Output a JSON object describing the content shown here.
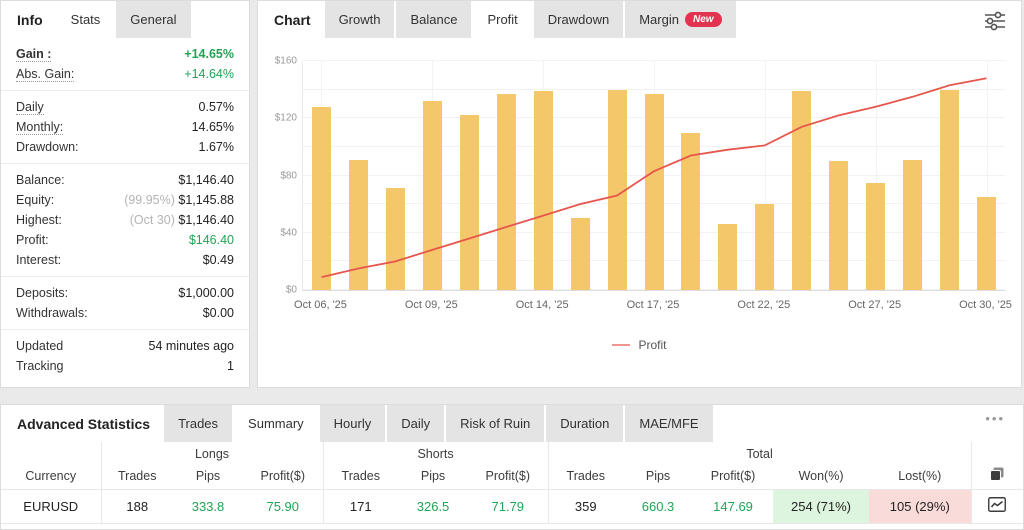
{
  "colors": {
    "green": "#22a455",
    "badge_red": "#e23350",
    "muted_prefix": "#b4b4b4"
  },
  "left_panel": {
    "title": "Info",
    "tabs": [
      {
        "label": "Stats",
        "active": true
      },
      {
        "label": "General",
        "active": false
      }
    ],
    "groups": [
      {
        "rows": [
          {
            "label": "Gain :",
            "value": "+14.65%",
            "label_class": "bold dotted",
            "value_class": "green bold"
          },
          {
            "label": "Abs. Gain:",
            "value": "+14.64%",
            "label_class": "dotted",
            "value_class": "green"
          }
        ]
      },
      {
        "rows": [
          {
            "label": "Daily",
            "value": "0.57%",
            "label_class": "dotted"
          },
          {
            "label": "Monthly:",
            "value": "14.65%",
            "label_class": "dotted"
          },
          {
            "label": "Drawdown:",
            "value": "1.67%"
          }
        ]
      },
      {
        "rows": [
          {
            "label": "Balance:",
            "value": "$1,146.40"
          },
          {
            "label": "Equity:",
            "prefix": "(99.95%) ",
            "value": "$1,145.88"
          },
          {
            "label": "Highest:",
            "prefix": "(Oct 30) ",
            "value": "$1,146.40"
          },
          {
            "label": "Profit:",
            "value": "$146.40",
            "value_class": "green"
          },
          {
            "label": "Interest:",
            "value": "$0.49"
          }
        ]
      },
      {
        "rows": [
          {
            "label": "Deposits:",
            "value": "$1,000.00"
          },
          {
            "label": "Withdrawals:",
            "value": "$0.00"
          }
        ]
      },
      {
        "rows": [
          {
            "label": "Updated",
            "value": "54 minutes ago"
          },
          {
            "label": "Tracking",
            "value": "1"
          }
        ]
      }
    ]
  },
  "chart_panel": {
    "title": "Chart",
    "tabs": [
      {
        "label": "Growth"
      },
      {
        "label": "Balance"
      },
      {
        "label": "Profit",
        "active": true
      },
      {
        "label": "Drawdown"
      },
      {
        "label": "Margin",
        "badge": "New"
      }
    ]
  },
  "chart_data": {
    "type": "bar",
    "title": "",
    "xlabel": "",
    "ylabel": "",
    "ylim": [
      0,
      160
    ],
    "ytick_major": 40,
    "ytick_minor": 20,
    "ytick_prefix": "$",
    "grid": true,
    "bar_color": "#f4c86a",
    "line_color": "#e6564d",
    "bars": [
      128,
      91,
      71,
      132,
      122,
      137,
      139,
      50,
      140,
      137,
      110,
      46,
      60,
      139,
      90,
      75,
      91,
      140,
      65
    ],
    "series": [
      {
        "name": "Profit",
        "type": "line",
        "values": [
          9,
          15,
          20,
          28,
          36,
          44,
          52,
          60,
          66,
          83,
          94,
          98,
          101,
          114,
          122,
          128,
          135,
          143,
          148
        ]
      }
    ],
    "xticks": [
      {
        "index": 0,
        "label": "Oct 06, '25"
      },
      {
        "index": 3,
        "label": "Oct 09, '25"
      },
      {
        "index": 6,
        "label": "Oct 14, '25"
      },
      {
        "index": 9,
        "label": "Oct 17, '25"
      },
      {
        "index": 12,
        "label": "Oct 22, '25"
      },
      {
        "index": 15,
        "label": "Oct 27, '25"
      },
      {
        "index": 18,
        "label": "Oct 30, '25"
      }
    ],
    "legend": [
      {
        "label": "Profit",
        "color": "#f0968e"
      }
    ],
    "legend_position": "bottom-center"
  },
  "bottom_panel": {
    "title": "Advanced Statistics",
    "tabs": [
      {
        "label": "Trades"
      },
      {
        "label": "Summary",
        "active": true
      },
      {
        "label": "Hourly"
      },
      {
        "label": "Daily"
      },
      {
        "label": "Risk of Ruin"
      },
      {
        "label": "Duration"
      },
      {
        "label": "MAE/MFE"
      }
    ],
    "menu": "•••",
    "table": {
      "corner_header": "Currency",
      "groups": [
        {
          "label": "Longs"
        },
        {
          "label": "Shorts"
        },
        {
          "label": "Total"
        }
      ],
      "columns": [
        "Trades",
        "Pips",
        "Profit($)",
        "Trades",
        "Pips",
        "Profit($)",
        "Trades",
        "Pips",
        "Profit($)",
        "Won(%)",
        "Lost(%)"
      ],
      "row": {
        "currency": "EURUSD",
        "longs_trades": "188",
        "longs_pips": "333.8",
        "longs_profit": "75.90",
        "shorts_trades": "171",
        "shorts_pips": "326.5",
        "shorts_profit": "71.79",
        "total_trades": "359",
        "total_pips": "660.3",
        "total_profit": "147.69",
        "won": "254 (71%)",
        "lost": "105 (29%)"
      },
      "won_bg": "#ddf5df",
      "lost_bg": "#f9dcda"
    }
  }
}
